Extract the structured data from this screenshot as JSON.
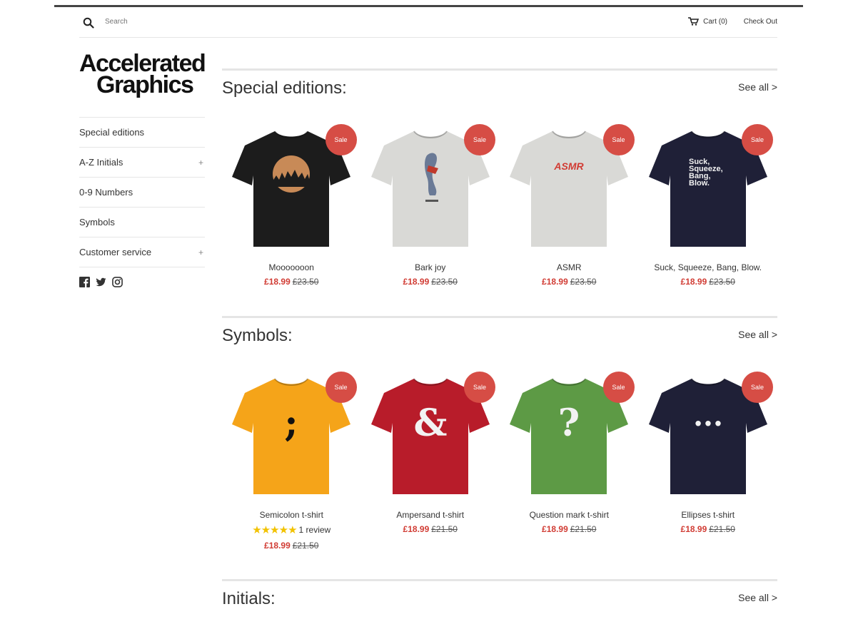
{
  "header": {
    "search_placeholder": "Search",
    "cart_label": "Cart (0)",
    "checkout_label": "Check Out"
  },
  "logo": {
    "line1": "Accelerated",
    "line2": "Graphics"
  },
  "sidebar": {
    "items": [
      {
        "label": "Special editions",
        "expandable": false
      },
      {
        "label": "A-Z Initials",
        "expandable": true
      },
      {
        "label": "0-9 Numbers",
        "expandable": false
      },
      {
        "label": "Symbols",
        "expandable": false
      },
      {
        "label": "Customer service",
        "expandable": true
      }
    ],
    "expand_symbol": "+",
    "social_icons": [
      "facebook-icon",
      "twitter-icon",
      "instagram-icon"
    ]
  },
  "sections": [
    {
      "title": "Special editions:",
      "see_all": "See all >",
      "products": [
        {
          "name": "Mooooooon",
          "badge": "Sale",
          "price": "£18.99",
          "was": "£23.50",
          "shirt_color": "#1c1c1c",
          "art": "moon"
        },
        {
          "name": "Bark joy",
          "badge": "Sale",
          "price": "£18.99",
          "was": "£23.50",
          "shirt_color": "#d9d9d6",
          "art": "dog"
        },
        {
          "name": "ASMR",
          "badge": "Sale",
          "price": "£18.99",
          "was": "£23.50",
          "shirt_color": "#d9d9d6",
          "art": "asmr",
          "art_text": "ASMR"
        },
        {
          "name": "Suck, Squeeze, Bang, Blow.",
          "badge": "Sale",
          "price": "£18.99",
          "was": "£23.50",
          "shirt_color": "#1f2037",
          "art": "text",
          "art_text": "Suck, Squeeze, Bang, Blow."
        }
      ]
    },
    {
      "title": "Symbols:",
      "see_all": "See all >",
      "products": [
        {
          "name": "Semicolon t-shirt",
          "badge": "Sale",
          "price": "£18.99",
          "was": "£21.50",
          "shirt_color": "#f5a419",
          "art": "glyph",
          "art_text": ";",
          "art_color": "#111111",
          "rating": 5,
          "rating_stars": "★★★★★",
          "review_text": "1 review"
        },
        {
          "name": "Ampersand t-shirt",
          "badge": "Sale",
          "price": "£18.99",
          "was": "£21.50",
          "shirt_color": "#b81c2a",
          "art": "glyph",
          "art_text": "&",
          "art_color": "#f2f2f2"
        },
        {
          "name": "Question mark t-shirt",
          "badge": "Sale",
          "price": "£18.99",
          "was": "£21.50",
          "shirt_color": "#5d9a45",
          "art": "glyph",
          "art_text": "?",
          "art_color": "#f2f2f2"
        },
        {
          "name": "Ellipses t-shirt",
          "badge": "Sale",
          "price": "£18.99",
          "was": "£21.50",
          "shirt_color": "#1f2037",
          "art": "glyph",
          "art_text": "...",
          "art_color": "#f2f2f2"
        }
      ]
    },
    {
      "title": "Initials:",
      "see_all": "See all >",
      "products": []
    }
  ],
  "colors": {
    "sale_badge": "#d64d45",
    "price_now": "#d13c34",
    "star": "#f2c200"
  }
}
